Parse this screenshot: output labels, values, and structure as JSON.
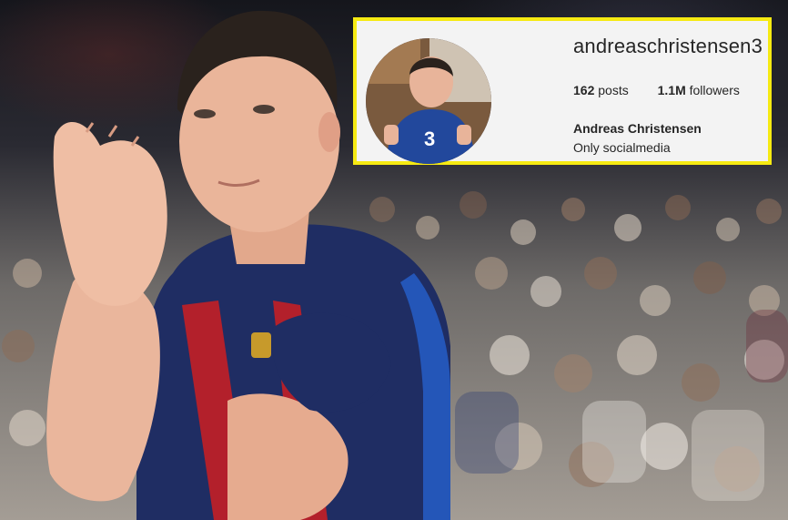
{
  "profile": {
    "username": "andreaschristensen3",
    "posts_count": "162",
    "posts_label": "posts",
    "followers_count": "1.1M",
    "followers_label": "followers",
    "full_name": "Andreas Christensen",
    "bio": "Only socialmedia"
  },
  "colors": {
    "highlight_border": "#f6ea12",
    "card_background": "#f3f3f3",
    "text": "#262626",
    "jersey_blue": "#1f2d63",
    "jersey_red": "#b3202b"
  }
}
